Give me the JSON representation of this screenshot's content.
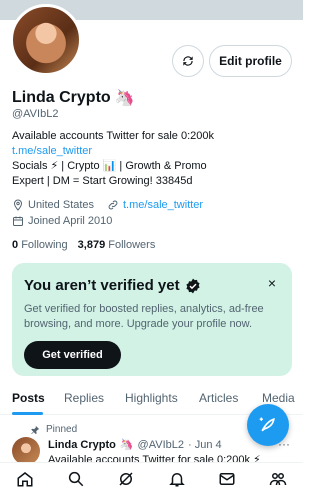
{
  "profile": {
    "name": "Linda Crypto",
    "name_emoji": "🦄",
    "handle": "@AVIbL2",
    "edit_label": "Edit profile",
    "bio_line1": "Available accounts Twitter for sale 0:200k",
    "bio_link": "t.me/sale_twitter",
    "bio_line3": "Socials ⚡ | Crypto 📊 | Growth & Promo",
    "bio_line4": "Expert | DM = Start Growing! 33845d",
    "location": "United States",
    "website": "t.me/sale_twitter",
    "joined": "Joined April 2010",
    "following_count": "0",
    "following_label": "Following",
    "followers_count": "3,879",
    "followers_label": "Followers"
  },
  "verify": {
    "title": "You aren’t verified yet",
    "description": "Get verified for boosted replies, analytics, ad-free browsing, and more. Upgrade your profile now.",
    "button": "Get verified",
    "close": "×"
  },
  "tabs": [
    "Posts",
    "Replies",
    "Highlights",
    "Articles",
    "Media"
  ],
  "post": {
    "pinned_label": "Pinned",
    "name": "Linda Crypto",
    "emoji": "🦄",
    "handle": "@AVIbL2",
    "time": "· Jun 4",
    "body": "Available accounts Twitter for sale 0:200k ⚡",
    "more": "···"
  },
  "colors": {
    "accent": "#1d9bf0",
    "verify_bg": "#d1f2e4",
    "text": "#0f1419",
    "muted": "#536471"
  },
  "icons": [
    "sync-icon",
    "location-icon",
    "link-icon",
    "calendar-icon",
    "verified-icon",
    "pin-icon",
    "compose-icon",
    "home-icon",
    "search-icon",
    "grok-icon",
    "notifications-icon",
    "messages-icon",
    "communities-icon"
  ]
}
